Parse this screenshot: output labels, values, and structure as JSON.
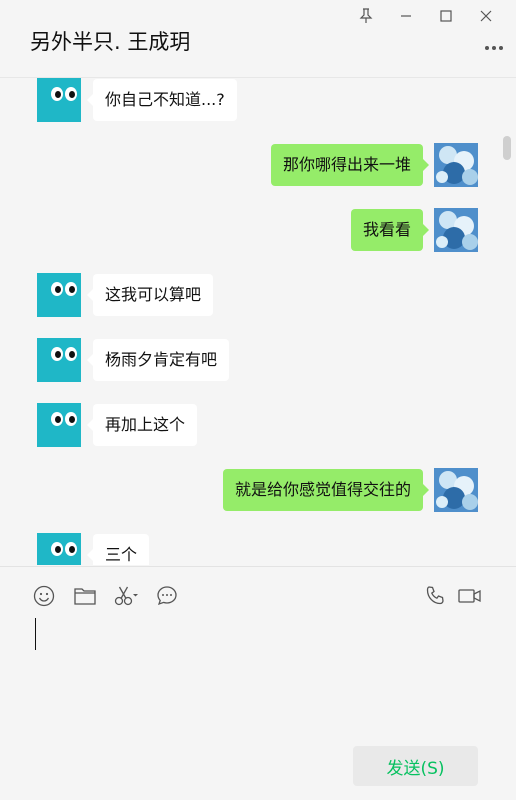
{
  "window": {
    "title": "另外半只. 王成玥",
    "controls": [
      "pin-icon",
      "minimize-icon",
      "maximize-icon",
      "close-icon"
    ]
  },
  "messages": [
    {
      "side": "left",
      "text": "你自己不知道...?"
    },
    {
      "side": "right",
      "text": "那你哪得出来一堆"
    },
    {
      "side": "right",
      "text": "我看看"
    },
    {
      "side": "left",
      "text": "这我可以算吧"
    },
    {
      "side": "left",
      "text": "杨雨夕肯定有吧"
    },
    {
      "side": "left",
      "text": "再加上这个"
    },
    {
      "side": "right",
      "text": "就是给你感觉值得交往的"
    },
    {
      "side": "left",
      "text": "三个"
    }
  ],
  "toolbar": {
    "left_tools": [
      "emoji-icon",
      "folder-icon",
      "scissors-icon",
      "chat-bubble-icon"
    ],
    "right_tools": [
      "phone-icon",
      "video-icon"
    ]
  },
  "input": {
    "value": ""
  },
  "send_button": {
    "label": "发送(S)"
  },
  "colors": {
    "sent_bubble": "#95ec69",
    "received_bubble": "#ffffff",
    "avatar_bg": "#1fb7c7",
    "send_text": "#07c160"
  }
}
